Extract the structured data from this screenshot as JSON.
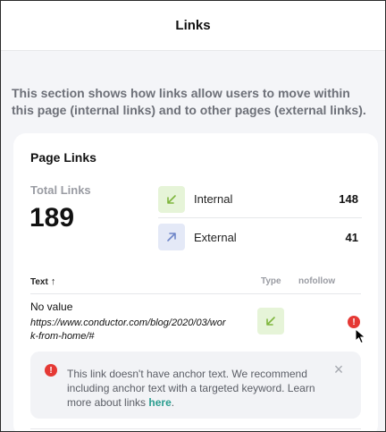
{
  "header": {
    "title": "Links"
  },
  "intro": {
    "text": "This section shows how links allow users to move within this page (internal links) and to other pages (external links)."
  },
  "card": {
    "title": "Page Links",
    "total_label": "Total Links",
    "total_value": "189",
    "stats": [
      {
        "label": "Internal",
        "count": "148",
        "icon": "arrow-down-left-icon",
        "color": "#7fb63d"
      },
      {
        "label": "External",
        "count": "41",
        "icon": "arrow-up-right-icon",
        "color": "#6f86c8"
      }
    ]
  },
  "table": {
    "headers": {
      "text": "Text",
      "text_sort": "↑",
      "type": "Type",
      "nofollow": "nofollow"
    },
    "rows": [
      {
        "anchor": "No value",
        "url": "https://www.conductor.com/blog/2020/03/work-from-home/#",
        "type_icon": "arrow-down-left-icon",
        "alert": "!"
      }
    ]
  },
  "notice": {
    "icon": "!",
    "text_before": "This link doesn't have anchor text. We recommend including anchor text with a targeted keyword. Learn more about links ",
    "link_text": "here",
    "text_after": ".",
    "close": "×"
  },
  "colors": {
    "accent_link": "#2a9d8f",
    "alert": "#e53935"
  }
}
